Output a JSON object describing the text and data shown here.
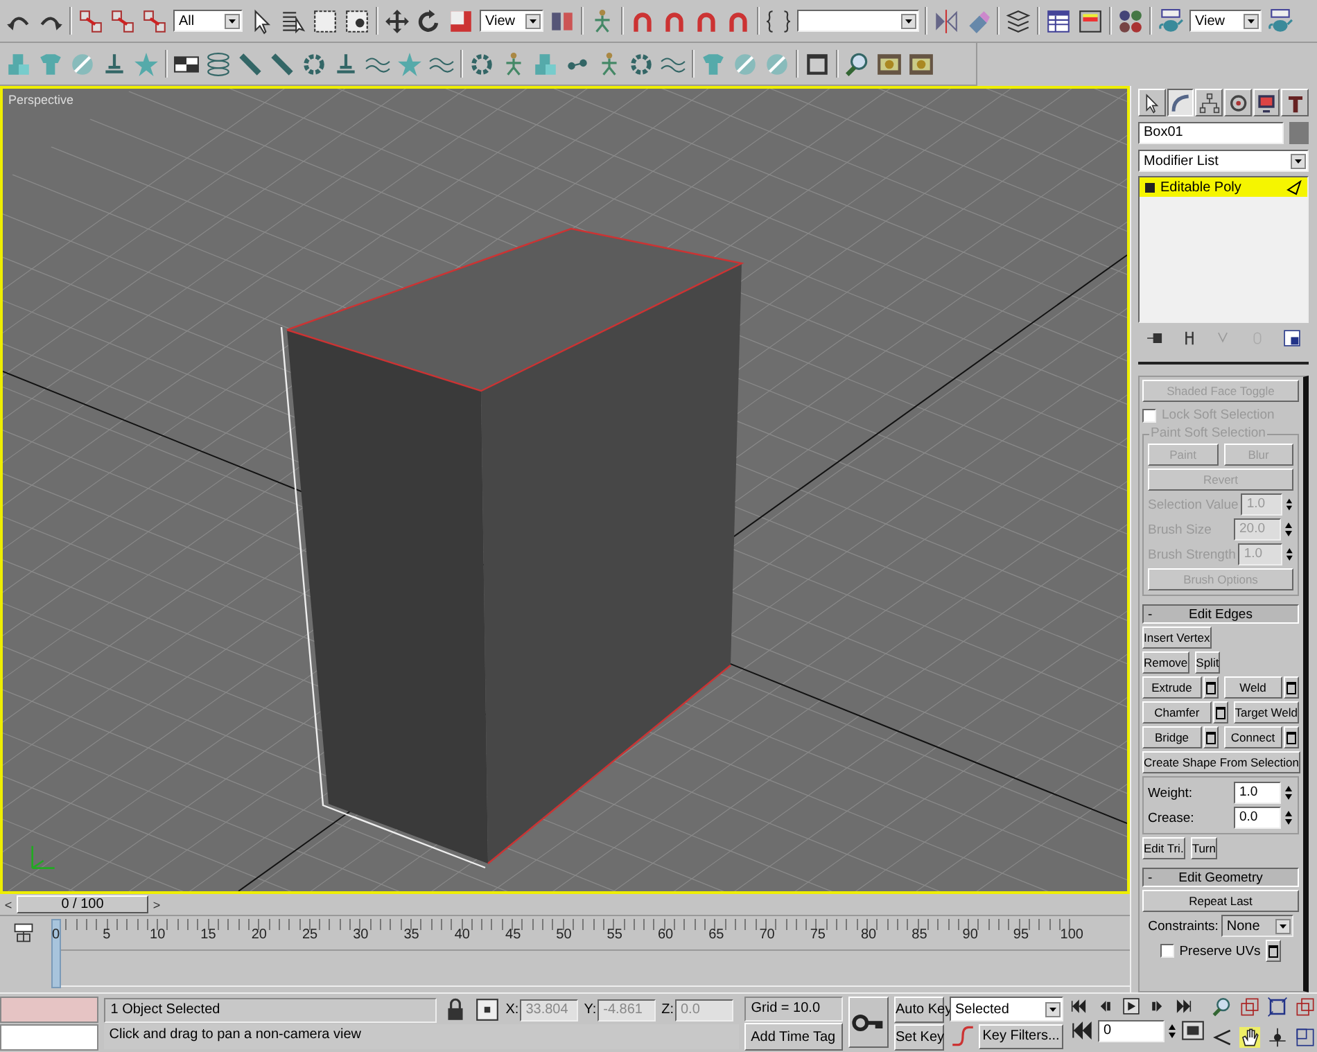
{
  "toolbar": {
    "selection_filter": "All",
    "coordinate_system": "View",
    "render_preset": "View"
  },
  "viewport": {
    "label": "Perspective",
    "active": true
  },
  "command_panel": {
    "tabs": [
      {
        "selected": false
      },
      {
        "selected": true
      },
      {
        "selected": false
      },
      {
        "selected": false
      },
      {
        "selected": false
      },
      {
        "selected": false
      }
    ],
    "object_name": "Box01",
    "modifier_list": "Modifier List",
    "stack": [
      {
        "label": "Editable Poly",
        "selected": true
      }
    ],
    "soft_selection": {
      "disabled": true,
      "shaded_face_toggle": "Shaded Face Toggle",
      "lock": {
        "label": "Lock Soft Selection",
        "checked": false
      },
      "paint_group": "Paint Soft Selection",
      "paint": "Paint",
      "blur": "Blur",
      "revert": "Revert",
      "spinners": [
        {
          "label": "Selection Value",
          "value": "1.0"
        },
        {
          "label": "Brush Size",
          "value": "20.0"
        },
        {
          "label": "Brush Strength",
          "value": "1.0"
        }
      ],
      "brush_options": "Brush Options"
    },
    "edit_edges": {
      "sign": "-",
      "title": "Edit Edges",
      "rows": [
        [
          {
            "label": "Insert Vertex",
            "settings": false
          }
        ],
        [
          {
            "label": "Remove",
            "settings": false
          },
          {
            "label": "Split",
            "settings": false
          }
        ],
        [
          {
            "label": "Extrude",
            "settings": true
          },
          {
            "label": "Weld",
            "settings": true
          }
        ],
        [
          {
            "label": "Chamfer",
            "settings": true
          },
          {
            "label": "Target Weld",
            "settings": false
          }
        ],
        [
          {
            "label": "Bridge",
            "settings": true
          },
          {
            "label": "Connect",
            "settings": true
          }
        ],
        [
          {
            "label": "Create Shape From Selection",
            "settings": false
          }
        ]
      ],
      "spinners": [
        {
          "label": "Weight:",
          "value": "1.0"
        },
        {
          "label": "Crease:",
          "value": "0.0"
        }
      ],
      "bottom": [
        {
          "label": "Edit Tri.",
          "settings": false
        },
        {
          "label": "Turn",
          "settings": false
        }
      ]
    },
    "edit_geometry": {
      "sign": "-",
      "title": "Edit Geometry",
      "repeat_last": "Repeat Last",
      "constraints": {
        "label": "Constraints:",
        "value": "None"
      },
      "preserve_uvs": {
        "label": "Preserve UVs",
        "checked": false
      }
    }
  },
  "time_slider": {
    "prev": "<",
    "label": "0 / 100",
    "next": ">",
    "level": 0
  },
  "track_bar": {
    "ticks": [
      "0",
      "5",
      "10",
      "15",
      "20",
      "25",
      "30",
      "35",
      "40",
      "45",
      "50",
      "55",
      "60",
      "65",
      "70",
      "75",
      "80",
      "85",
      "90",
      "95",
      "100"
    ]
  },
  "status": {
    "selection": "1 Object Selected",
    "prompt": "Click and drag to pan a non-camera view",
    "coords": [
      {
        "label": "X:",
        "value": "33.804"
      },
      {
        "label": "Y:",
        "value": "-4.861"
      },
      {
        "label": "Z:",
        "value": "0.0"
      }
    ],
    "grid": "Grid = 10.0",
    "time_tag": "Add Time Tag"
  },
  "animation": {
    "auto_key": "Auto Key",
    "set_key": "Set Key",
    "key_mode": "Selected",
    "key_filters": "Key Filters...",
    "frame": "0"
  }
}
